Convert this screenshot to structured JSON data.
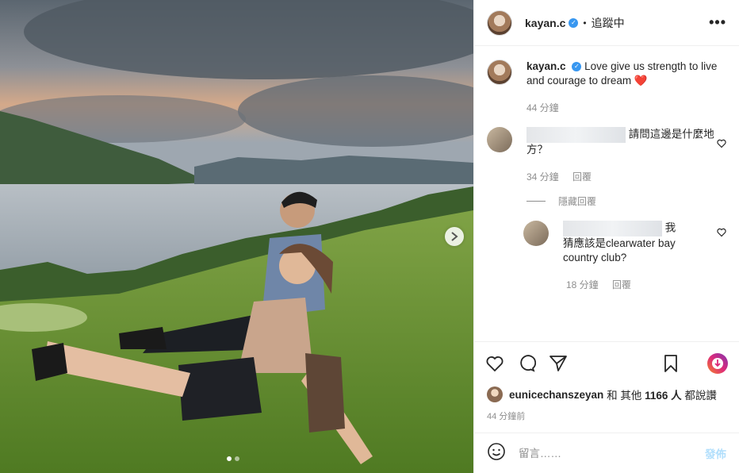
{
  "post": {
    "author": "kayan.c",
    "follow_status": "追蹤中",
    "separator": "•",
    "more_label": "•••"
  },
  "caption": {
    "author": "kayan.c",
    "text": "Love give us strength to live and courage to dream",
    "emoji": "❤️",
    "time": "44 分鐘"
  },
  "comments": [
    {
      "text": "請問這邊是什麼地方？",
      "time": "34 分鐘",
      "reply_label": "回覆"
    }
  ],
  "hide_replies_label": "隱藏回覆",
  "replies": [
    {
      "text": "我猜應該是clearwater bay country club?",
      "time": "18 分鐘",
      "reply_label": "回覆"
    }
  ],
  "likes": {
    "liker": "eunicechanszeyan",
    "connector": "和 其他",
    "count": "1166 人",
    "suffix": "都說讚"
  },
  "posted_time": "44 分鐘前",
  "add_comment": {
    "placeholder": "留言……",
    "post_label": "發佈"
  },
  "carousel": {
    "total": 2,
    "current": 1
  },
  "icons": [
    "verified-icon",
    "more-icon",
    "heart-icon",
    "comment-icon",
    "share-icon",
    "save-icon",
    "next-arrow-icon",
    "emoji-icon"
  ]
}
